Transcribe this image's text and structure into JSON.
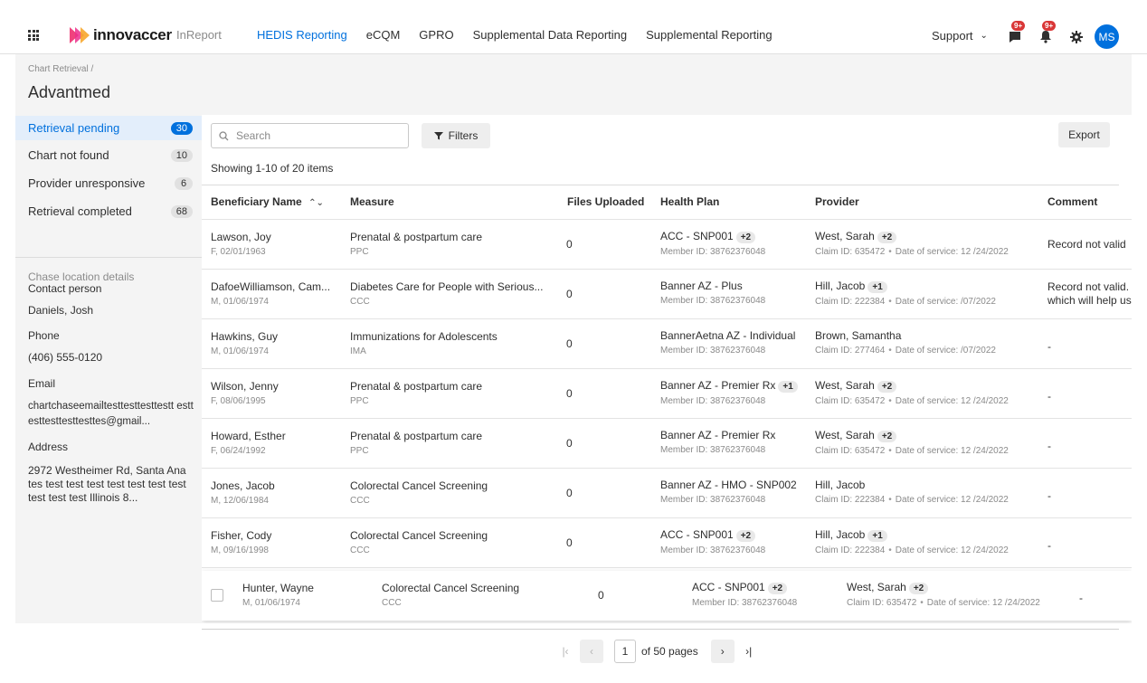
{
  "app": {
    "logo_text": "innovaccer",
    "product_name": "InReport"
  },
  "nav": {
    "items": [
      {
        "label": "HEDIS Reporting",
        "active": true
      },
      {
        "label": "eCQM",
        "active": false
      },
      {
        "label": "GPRO",
        "active": false
      },
      {
        "label": "Supplemental Data Reporting",
        "active": false
      },
      {
        "label": "Supplemental Reporting",
        "active": false
      }
    ],
    "support_label": "Support",
    "messages_badge": "9+",
    "notifications_badge": "9+",
    "avatar_initials": "MS"
  },
  "page": {
    "breadcrumb": "Chart Retrieval /",
    "title": "Advantmed"
  },
  "status_filters": [
    {
      "label": "Retrieval pending",
      "count": "30",
      "active": true
    },
    {
      "label": "Chart not found",
      "count": "10",
      "active": false
    },
    {
      "label": "Provider unresponsive",
      "count": "6",
      "active": false
    },
    {
      "label": "Retrieval completed",
      "count": "68",
      "active": false
    }
  ],
  "chase_location": {
    "heading": "Chase location details",
    "contact_label": "Contact person",
    "contact_value": "Daniels, Josh",
    "phone_label": "Phone",
    "phone_value": "(406) 555-0120",
    "email_label": "Email",
    "email_value": "chartchaseemailtesttesttesttestt esttesttesttesttesttes@gmail...",
    "address_label": "Address",
    "address_value": "2972 Westheimer Rd, Santa Ana tes test test test test test test test test test test Illinois 8..."
  },
  "toolbar": {
    "search_placeholder": "Search",
    "filters_label": "Filters",
    "export_label": "Export",
    "showing_text": "Showing 1-10 of 20 items"
  },
  "table": {
    "headers": {
      "beneficiary": "Beneficiary Name",
      "measure": "Measure",
      "files": "Files Uploaded",
      "plan": "Health Plan",
      "provider": "Provider",
      "comment": "Comment"
    },
    "rows": [
      {
        "name": "Lawson, Joy",
        "demo": "F, 02/01/1963",
        "measure": "Prenatal & postpartum care",
        "measure_code": "PPC",
        "files": "0",
        "plan": "ACC - SNP001",
        "plan_plus": "+2",
        "member": "Member ID: 38762376048",
        "provider": "West, Sarah",
        "provider_plus": "+2",
        "claim": "Claim ID: 635472",
        "dos": "Date of service: 12 /24/2022",
        "comment": "Record not valid",
        "comment2": ""
      },
      {
        "name": "DafoeWilliamson, Cam...",
        "demo": "M, 01/06/1974",
        "measure": "Diabetes Care for People with Serious...",
        "measure_code": "CCC",
        "files": "0",
        "plan": "Banner AZ - Plus",
        "plan_plus": "",
        "member": "Member ID: 38762376048",
        "provider": "Hill, Jacob",
        "provider_plus": "+1",
        "claim": "Claim ID: 222384",
        "dos": "Date of service: /07/2022",
        "comment": "Record not valid.",
        "comment2": "which will help us"
      },
      {
        "name": "Hawkins, Guy",
        "demo": "M, 01/06/1974",
        "measure": "Immunizations for Adolescents",
        "measure_code": "IMA",
        "files": "0",
        "plan": "BannerAetna AZ - Individual",
        "plan_plus": "",
        "member": "Member ID: 38762376048",
        "provider": "Brown, Samantha",
        "provider_plus": "",
        "claim": "Claim ID: 277464",
        "dos": "Date of service: /07/2022",
        "comment": "-",
        "comment2": ""
      },
      {
        "name": "Wilson, Jenny",
        "demo": "F, 08/06/1995",
        "measure": "Prenatal & postpartum care",
        "measure_code": "PPC",
        "files": "0",
        "plan": "Banner AZ - Premier Rx",
        "plan_plus": "+1",
        "member": "Member ID: 38762376048",
        "provider": "West, Sarah",
        "provider_plus": "+2",
        "claim": "Claim ID: 635472",
        "dos": "Date of service: 12 /24/2022",
        "comment": "-",
        "comment2": ""
      },
      {
        "name": "Howard, Esther",
        "demo": "F, 06/24/1992",
        "measure": "Prenatal & postpartum care",
        "measure_code": "PPC",
        "files": "0",
        "plan": "Banner AZ - Premier Rx",
        "plan_plus": "",
        "member": "Member ID: 38762376048",
        "provider": "West, Sarah",
        "provider_plus": "+2",
        "claim": "Claim ID: 635472",
        "dos": "Date of service: 12 /24/2022",
        "comment": "-",
        "comment2": ""
      },
      {
        "name": "Jones, Jacob",
        "demo": "M, 12/06/1984",
        "measure": "Colorectal Cancel Screening",
        "measure_code": "CCC",
        "files": "0",
        "plan": "Banner AZ - HMO - SNP002",
        "plan_plus": "",
        "member": "Member ID: 38762376048",
        "provider": "Hill, Jacob",
        "provider_plus": "",
        "claim": "Claim ID: 222384",
        "dos": "Date of service: 12 /24/2022",
        "comment": "-",
        "comment2": ""
      },
      {
        "name": "Fisher, Cody",
        "demo": "M, 09/16/1998",
        "measure": "Colorectal Cancel Screening",
        "measure_code": "CCC",
        "files": "0",
        "plan": "ACC - SNP001",
        "plan_plus": "+2",
        "member": "Member ID: 38762376048",
        "provider": "Hill, Jacob",
        "provider_plus": "+1",
        "claim": "Claim ID: 222384",
        "dos": "Date of service: 12 /24/2022",
        "comment": "-",
        "comment2": ""
      },
      {
        "name": "Hunter, Wayne",
        "demo": "M, 01/06/1974",
        "measure": "Colorectal Cancel Screening",
        "measure_code": "CCC",
        "files": "0",
        "plan": "ACC - SNP001",
        "plan_plus": "+2",
        "member": "Member ID: 38762376048",
        "provider": "West, Sarah",
        "provider_plus": "+2",
        "claim": "Claim ID: 635472",
        "dos": "Date of service: 12 /24/2022",
        "comment": "-",
        "comment2": ""
      }
    ]
  },
  "pagination": {
    "current_page": "1",
    "of_text": "of 50 pages"
  },
  "colors": {
    "accent": "#0070dd",
    "badge": "#d93737"
  }
}
